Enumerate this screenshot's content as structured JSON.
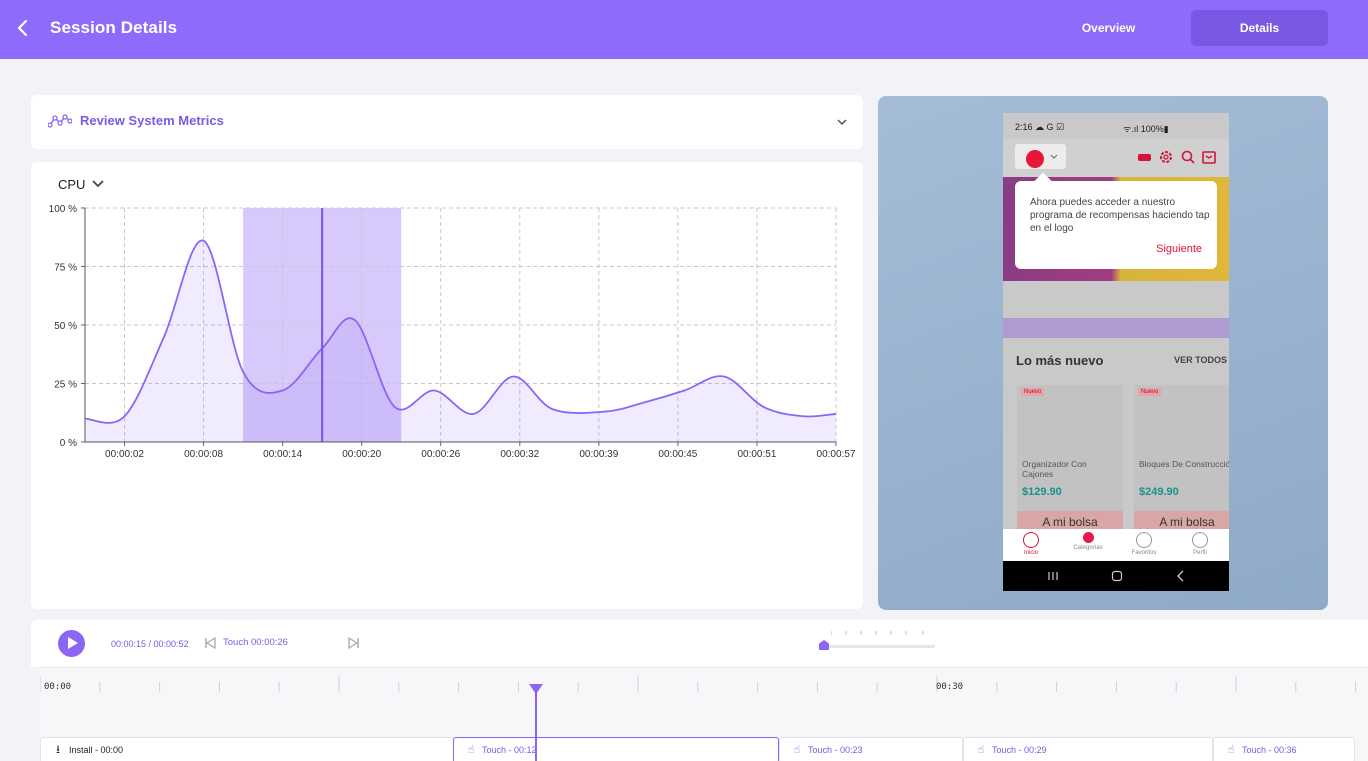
{
  "header": {
    "title": "Session Details",
    "tabs": [
      {
        "label": "Overview",
        "active": false
      },
      {
        "label": "Details",
        "active": true
      }
    ],
    "accent": "#8e6bfa"
  },
  "metrics_panel": {
    "label": "Review System Metrics",
    "selected_metric": "CPU"
  },
  "chart_data": {
    "type": "area",
    "title": "",
    "ylabel": "",
    "xlabel": "",
    "ylim": [
      0,
      100
    ],
    "y_ticks": [
      "0 %",
      "25 %",
      "50 %",
      "75 %",
      "100 %"
    ],
    "x_ticks": [
      "00:00:02",
      "00:00:08",
      "00:00:14",
      "00:00:20",
      "00:00:26",
      "00:00:32",
      "00:00:39",
      "00:00:45",
      "00:00:51",
      "00:00:57"
    ],
    "x_range_seconds": [
      0,
      57
    ],
    "x_seconds": [
      0,
      3,
      6,
      9,
      12,
      15,
      18,
      20.5,
      23.5,
      26.5,
      29.5,
      32.5,
      35.5,
      39.5,
      42.5,
      45.5,
      48.5,
      51.5,
      54.5,
      57
    ],
    "values": [
      10,
      11,
      45,
      86,
      30,
      22,
      40,
      52,
      15,
      22,
      12,
      28,
      14,
      13,
      17,
      22,
      28,
      15,
      11,
      12
    ],
    "highlight_range_seconds": [
      12,
      24
    ],
    "cursor_seconds": 18,
    "series_color": "#8b66f5",
    "grid": true
  },
  "device_screen": {
    "status_time": "2:16 ☁ G ☑",
    "status_battery": "ᯤ.ıl 100%▮",
    "popup_text": "Ahora puedes acceder a nuestro programa de recompensas haciendo tap en el logo",
    "popup_action": "Siguiente",
    "section_title": "Lo más nuevo",
    "section_link": "VER TODOS",
    "products": [
      {
        "badge": "Nuevo",
        "name": "Organizador Con Cajones",
        "price": "$129.90",
        "cta": "A mi bolsa"
      },
      {
        "badge": "Nuevo",
        "name": "Bloques De Construcción",
        "price": "$249.90",
        "cta": "A mi bolsa"
      }
    ],
    "nav": [
      "Inicio",
      "Categorías",
      "Favoritos",
      "Perfil"
    ]
  },
  "player": {
    "time": "00:00:15 / 00:00:52",
    "touch_label": "Touch 00:00:26"
  },
  "timeline": {
    "labels": [
      "00:00",
      "00:30"
    ],
    "events": [
      {
        "label": "Install - 00:00",
        "icon": "download-icon"
      },
      {
        "label": "Touch - 00:12",
        "icon": "touch-icon"
      },
      {
        "label": "Touch - 00:23",
        "icon": "touch-icon"
      },
      {
        "label": "Touch - 00:29",
        "icon": "touch-icon"
      },
      {
        "label": "Touch - 00:36",
        "icon": "touch-icon"
      }
    ]
  }
}
